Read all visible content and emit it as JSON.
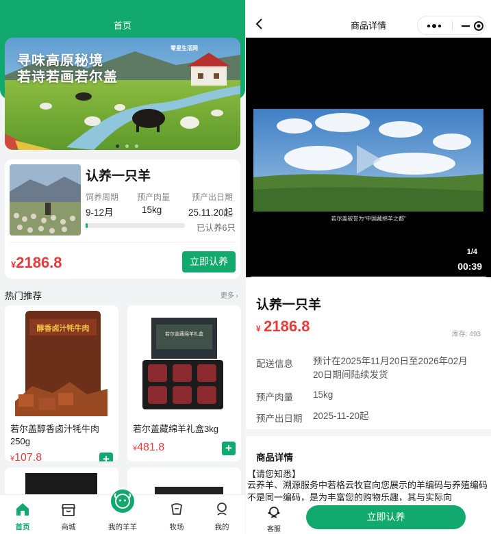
{
  "left": {
    "title": "首页",
    "banner": {
      "line1": "寻味高原秘境",
      "line2": "若诗若画若尔盖",
      "brand": "零星生活网"
    },
    "product": {
      "title": "认养一只羊",
      "labels": [
        "饲养周期",
        "预产肉量",
        "预产出日期"
      ],
      "values": [
        "9-12月",
        "15kg",
        "25.11.20起"
      ],
      "progress": 0.02,
      "adopted": "已认养6只",
      "currency": "¥",
      "price": "2186.8",
      "button": "立即认养"
    },
    "hot": {
      "title": "热门推荐",
      "more": "更多"
    },
    "goods": [
      {
        "name": "若尔盖醇香卤汁牦牛肉250g",
        "price": "107.8",
        "currency": "¥",
        "pack_text": "醇香卤汁牦牛肉"
      },
      {
        "name": "若尔盖藏绵羊礼盒3kg",
        "price": "481.8",
        "currency": "¥",
        "pack_text": "若尔盖藏绵羊礼盒"
      }
    ],
    "tabs": [
      "首页",
      "商城",
      "我的羊羊",
      "牧场",
      "我的"
    ],
    "accent": "#12a96e"
  },
  "right": {
    "title": "商品详情",
    "video": {
      "caption": "若尔盖被誉为“中国藏绵羊之都”",
      "index": "1/4",
      "time": "00:39"
    },
    "name": "认养一只羊",
    "currency": "¥",
    "price": "2186.8",
    "stock": "库存: 493",
    "spec": {
      "delivery_label": "配送信息",
      "delivery_value": "预计在2025年11月20日至2026年02月20日期间陆续发货",
      "meat_label": "预产肉量",
      "meat_value": "15kg",
      "date_label": "预产出日期",
      "date_value": "2025-11-20起"
    },
    "detail": {
      "title": "商品详情",
      "notice": "【请您知悉】",
      "body": "云养羊、溯源服务中若格云牧官向您展示的羊编码与养殖编码不是同一编码，是为丰富您的购物乐趣，其与实际向"
    },
    "service": "客服",
    "buy": "立即认养"
  }
}
